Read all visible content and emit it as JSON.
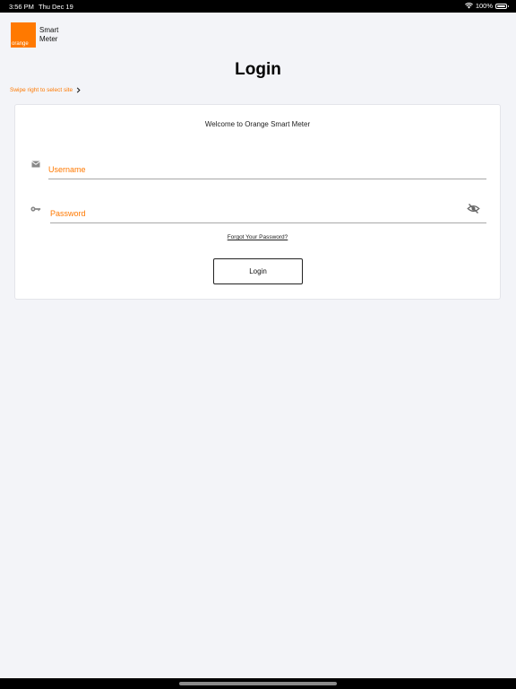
{
  "status_bar": {
    "time": "3:56 PM",
    "date": "Thu Dec 19",
    "battery": "100%",
    "icons": [
      "wifi-icon",
      "battery-icon"
    ]
  },
  "logo": {
    "word": "orange",
    "app_name_line1": "Smart",
    "app_name_line2": "Meter"
  },
  "page": {
    "title": "Login",
    "swipe_hint": "Swipe right to select site"
  },
  "form": {
    "welcome": "Welcome to Orange Smart Meter",
    "username": {
      "placeholder": "Username",
      "value": "",
      "icon": "mail-icon"
    },
    "password": {
      "placeholder": "Password",
      "value": "",
      "icon": "key-icon",
      "toggle_icon": "eye-off-icon"
    },
    "forgot_label": "Forgot Your Password?",
    "login_label": "Login"
  },
  "colors": {
    "accent": "#ff7900",
    "background": "#f3f4f8",
    "card": "#ffffff",
    "text": "#111111"
  }
}
